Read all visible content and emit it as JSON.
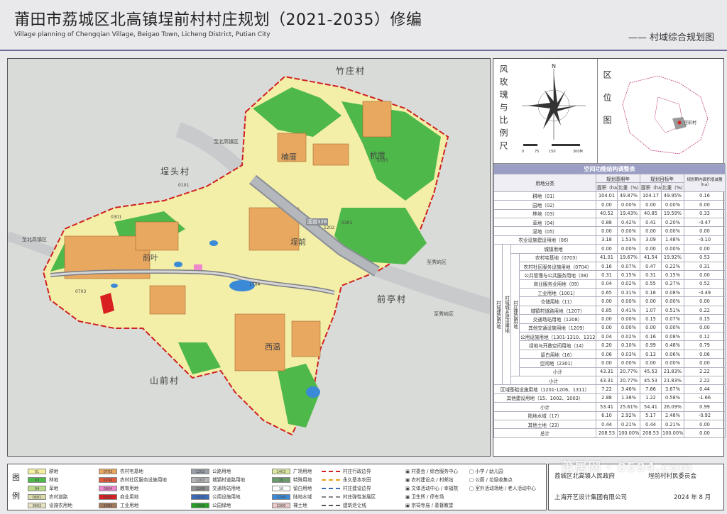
{
  "header": {
    "title": "莆田市荔城区北高镇埕前村村庄规划（2021-2035）修编",
    "subtitle": "Village planning of Chengqian Village, Beigao Town, Licheng District, Putian City",
    "sheet_name": "—— 村域综合规划图"
  },
  "map": {
    "neighbors": {
      "north": "竹庄村",
      "west": "埕头村",
      "east": "前亭村",
      "south": "山前村"
    },
    "settlements": [
      "前叶",
      "埕前",
      "楠厝",
      "杭厝",
      "西温"
    ],
    "roads": [
      "至北高镇区",
      "至北高镇区",
      "至秀屿区",
      "至秀屿区"
    ],
    "road_badge": "国道328",
    "land_codes": [
      "0101",
      "0103",
      "0301",
      "0703",
      "1202",
      "1704",
      "0301"
    ]
  },
  "rose": {
    "title_vertical": "风玫瑰与比例尺",
    "north_letter": "N",
    "scale_labels": [
      "0",
      "75",
      "150",
      "300M"
    ]
  },
  "location": {
    "title_vertical": "区位图",
    "marker": "埕前村"
  },
  "table": {
    "caption": "空间功能结构调整表",
    "col_land": "用地分类",
    "col_base": "规划基期年",
    "col_target": "规划目标年",
    "col_change": "规划期内面积增减量（ha）",
    "sub_area": "面积（ha）",
    "sub_ratio": "比重（%）",
    "group_outer": "村域建设用地",
    "group_inner": "村庄建设用地",
    "group_mid": "村域城乡建设用地",
    "rows": [
      {
        "name": "耕地（01）",
        "a1": "104.01",
        "r1": "49.87%",
        "a2": "104.17",
        "r2": "49.95%",
        "d": "0.16"
      },
      {
        "name": "园地（02）",
        "a1": "0.00",
        "r1": "0.00%",
        "a2": "0.00",
        "r2": "0.00%",
        "d": "0.00"
      },
      {
        "name": "林地（03）",
        "a1": "40.52",
        "r1": "19.43%",
        "a2": "40.85",
        "r2": "19.59%",
        "d": "0.33"
      },
      {
        "name": "草地（04）",
        "a1": "0.88",
        "r1": "0.42%",
        "a2": "0.41",
        "r2": "0.20%",
        "d": "-0.47"
      },
      {
        "name": "湿地（05）",
        "a1": "0.00",
        "r1": "0.00%",
        "a2": "0.00",
        "r2": "0.00%",
        "d": "0.00"
      },
      {
        "name": "农业设施建设用地（06）",
        "a1": "3.18",
        "r1": "1.53%",
        "a2": "3.09",
        "r2": "1.48%",
        "d": "-0.10"
      },
      {
        "name": "城镇用地",
        "a1": "0.00",
        "r1": "0.00%",
        "a2": "0.00",
        "r2": "0.00%",
        "d": "0.00"
      },
      {
        "name": "农村宅基地（0703）",
        "a1": "41.01",
        "r1": "19.67%",
        "a2": "41.54",
        "r2": "19.92%",
        "d": "0.53"
      },
      {
        "name": "农村社区服务设施用地（0704）",
        "a1": "0.16",
        "r1": "0.07%",
        "a2": "0.47",
        "r2": "0.22%",
        "d": "0.31"
      },
      {
        "name": "公共管理与公共服务用地（08）",
        "a1": "0.31",
        "r1": "0.15%",
        "a2": "0.31",
        "r2": "0.15%",
        "d": "0.00"
      },
      {
        "name": "商业服务业用地（09）",
        "a1": "0.04",
        "r1": "0.02%",
        "a2": "0.55",
        "r2": "0.27%",
        "d": "0.52"
      },
      {
        "name": "工业用地（1001）",
        "a1": "0.65",
        "r1": "0.31%",
        "a2": "0.16",
        "r2": "0.08%",
        "d": "-0.49"
      },
      {
        "name": "仓储用地（11）",
        "a1": "0.00",
        "r1": "0.00%",
        "a2": "0.00",
        "r2": "0.00%",
        "d": "0.00"
      },
      {
        "name": "城镇村道路用地（1207）",
        "a1": "0.85",
        "r1": "0.41%",
        "a2": "1.07",
        "r2": "0.51%",
        "d": "0.22"
      },
      {
        "name": "交通场站用地（1208）",
        "a1": "0.00",
        "r1": "0.00%",
        "a2": "0.15",
        "r2": "0.07%",
        "d": "0.15"
      },
      {
        "name": "其他交通设施用地（1209）",
        "a1": "0.00",
        "r1": "0.00%",
        "a2": "0.00",
        "r2": "0.00%",
        "d": "0.00"
      },
      {
        "name": "公用设施用地（1301-1310、1312）",
        "a1": "0.04",
        "r1": "0.02%",
        "a2": "0.16",
        "r2": "0.08%",
        "d": "0.12"
      },
      {
        "name": "绿地与开敞空间用地（14）",
        "a1": "0.20",
        "r1": "0.10%",
        "a2": "0.99",
        "r2": "0.48%",
        "d": "0.79"
      },
      {
        "name": "留白用地（16）",
        "a1": "0.06",
        "r1": "0.03%",
        "a2": "0.13",
        "r2": "0.06%",
        "d": "0.06"
      },
      {
        "name": "空闲地（2301）",
        "a1": "0.00",
        "r1": "0.00%",
        "a2": "0.00",
        "r2": "0.00%",
        "d": "0.00"
      },
      {
        "name": "小计",
        "a1": "43.31",
        "r1": "20.77%",
        "a2": "45.53",
        "r2": "21.83%",
        "d": "2.22"
      },
      {
        "name": "小计",
        "a1": "43.31",
        "r1": "20.77%",
        "a2": "45.53",
        "r2": "21.83%",
        "d": "2.22"
      },
      {
        "name": "区域基础设施用地（1201-1206、1311）",
        "a1": "7.22",
        "r1": "3.46%",
        "a2": "7.66",
        "r2": "3.67%",
        "d": "0.44"
      },
      {
        "name": "其他建设用地（15、1002、1003）",
        "a1": "2.88",
        "r1": "1.38%",
        "a2": "1.22",
        "r2": "0.58%",
        "d": "-1.66"
      },
      {
        "name": "小计",
        "a1": "53.41",
        "r1": "25.61%",
        "a2": "54.41",
        "r2": "26.09%",
        "d": "0.99"
      },
      {
        "name": "陆地水域（17）",
        "a1": "6.10",
        "r1": "2.92%",
        "a2": "5.17",
        "r2": "2.48%",
        "d": "-0.92"
      },
      {
        "name": "其他土地（23）",
        "a1": "0.44",
        "r1": "0.21%",
        "a2": "0.44",
        "r2": "0.21%",
        "d": "0.00"
      },
      {
        "name": "总计",
        "a1": "208.53",
        "r1": "100.00%",
        "a2": "208.53",
        "r2": "100.00%",
        "d": "0.00"
      }
    ]
  },
  "legend": {
    "title": "图例",
    "items": [
      {
        "code": "01",
        "label": "耕地",
        "color": "#f4f0a0"
      },
      {
        "code": "03",
        "label": "林地",
        "color": "#4fb84a"
      },
      {
        "code": "04",
        "label": "草地",
        "color": "#b9d98a"
      },
      {
        "code": "0601",
        "label": "农村道路",
        "color": "#d8d8a8"
      },
      {
        "code": "0602",
        "label": "设施农用地",
        "color": "#e6e2c0"
      },
      {
        "code": "0703",
        "label": "农村宅基地",
        "color": "#e8a860"
      },
      {
        "code": "0704",
        "label": "农村社区服务设施用地",
        "color": "#e05a3c"
      },
      {
        "code": "0804",
        "label": "教育用地",
        "color": "#ee88cc"
      },
      {
        "code": "0901",
        "label": "商业用地",
        "color": "#d82020"
      },
      {
        "code": "1001",
        "label": "工业用地",
        "color": "#a0785a"
      },
      {
        "code": "1202",
        "label": "公路用地",
        "color": "#9aa0a8"
      },
      {
        "code": "1207",
        "label": "城镇村道路用地",
        "color": "#b4b4b4"
      },
      {
        "code": "1208",
        "label": "交通场站用地",
        "color": "#909090"
      },
      {
        "code": "1311",
        "label": "公用设施用地",
        "color": "#3a6ab8"
      },
      {
        "code": "1401",
        "label": "公园绿地",
        "color": "#28a028"
      },
      {
        "code": "1403",
        "label": "广场用地",
        "color": "#dde6a0"
      },
      {
        "code": "15",
        "label": "特殊用地",
        "color": "#6a9a6a"
      },
      {
        "code": "16",
        "label": "留白用地",
        "color": "#ffffff"
      },
      {
        "code": "1704",
        "label": "陆地水域",
        "color": "#3a8ad8"
      },
      {
        "code": "2306",
        "label": "裸土地",
        "color": "#e8c8c8"
      }
    ],
    "line_items": [
      "村庄行政边界",
      "永久基本农田",
      "村庄建设边界",
      "村庄弹性发展区",
      "建筑退让线"
    ],
    "facility_items": [
      "村委会 / 综合服务中心",
      "农村建设点 / 村邮站",
      "文体活动中心 / 幸福院",
      "卫生所 / 停车场",
      "宗祠寺庙 / 基督教堂"
    ],
    "facility_items2": [
      "小学 / 幼儿园",
      "公厕 / 垃圾收集点",
      "室外活动场地 / 老人活动中心"
    ]
  },
  "footer": {
    "gov": "荔城区北高镇人民政府",
    "committee": "埕前村村民委员会",
    "company": "上海开艺设计集团有限公司",
    "date": "2024 年 8 月"
  },
  "watermark": "莆居网 · 0594.com"
}
